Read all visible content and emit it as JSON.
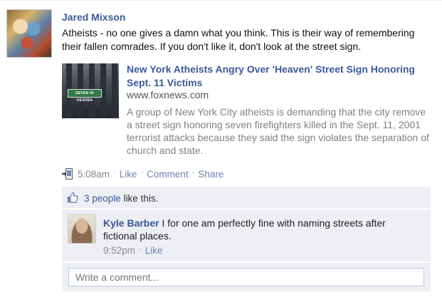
{
  "post": {
    "author": "Jared Mixson",
    "message": "Atheists - no one gives a damn what you think. This is their way of remembering their fallen comrades. If you don't like it, don't look at the street sign.",
    "attachment": {
      "title": "New York Atheists Angry Over 'Heaven' Street Sign Honoring Sept. 11 Victims",
      "domain": "www.foxnews.com",
      "description": "A group of New York City atheists is demanding that the city remove a street sign honoring seven firefighters killed in the Sept. 11, 2001 terrorist attacks because they said the sign violates the separation of church and state.",
      "thumb_sign_text": "SEVEN IN HEAVEN"
    },
    "time": "5:08am",
    "actions": {
      "like": "Like",
      "comment": "Comment",
      "share": "Share"
    }
  },
  "likes": {
    "people": "3 people",
    "suffix": " like this."
  },
  "comment": {
    "author": "Kyle Barber",
    "text": "I for one am perfectly fine with naming streets after fictional places.",
    "time": "9:52pm",
    "like": "Like"
  },
  "write_comment": {
    "placeholder": "Write a comment..."
  },
  "colors": {
    "link": "#3b5998",
    "action_link": "#6d84b4",
    "panel_bg": "#edeff4"
  }
}
